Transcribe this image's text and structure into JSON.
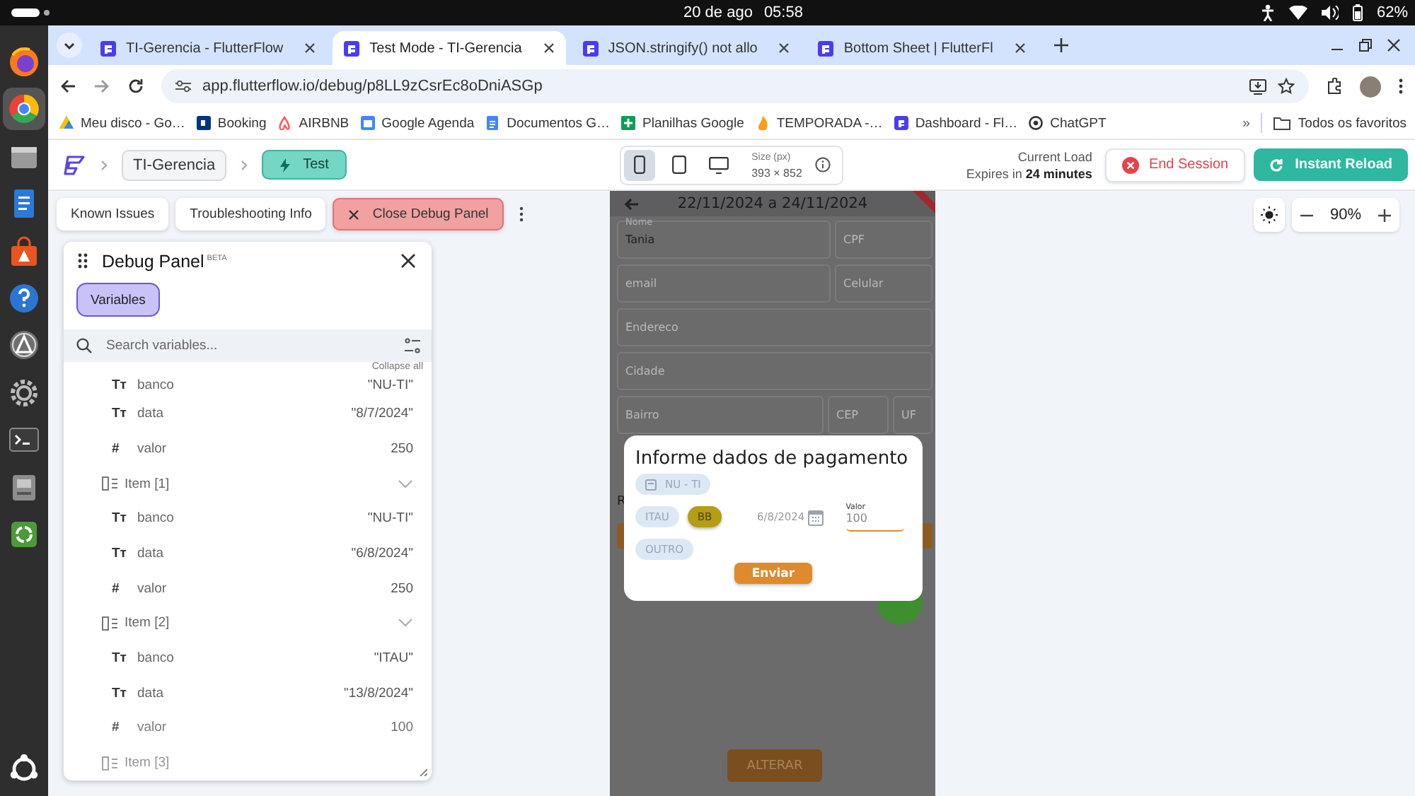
{
  "system_bar": {
    "date": "20 de ago",
    "time": "05:58",
    "battery": "62%"
  },
  "dock": {
    "apps": [
      {
        "kind": "globe",
        "selected": false
      },
      {
        "kind": "ring",
        "selected": true
      },
      {
        "kind": "drawer",
        "selected": false
      },
      {
        "kind": "document",
        "selected": false
      },
      {
        "kind": "bag",
        "selected": false
      },
      {
        "kind": "help",
        "selected": false
      },
      {
        "kind": "triangle",
        "selected": false
      },
      {
        "kind": "gear",
        "selected": false
      },
      {
        "kind": "terminal",
        "selected": false
      },
      {
        "kind": "disk",
        "selected": false
      },
      {
        "kind": "recycle",
        "selected": false
      }
    ]
  },
  "browser": {
    "tabs": [
      {
        "label": "TI-Gerencia - FlutterFlow",
        "selected": false
      },
      {
        "label": "Test Mode - TI-Gerencia",
        "selected": true
      },
      {
        "label": "JSON.stringify() not allo",
        "selected": false
      },
      {
        "label": "Bottom Sheet | FlutterFl",
        "selected": false
      }
    ],
    "url": "app.flutterflow.io/debug/p8LL9zCsrEc8oDniASGp",
    "bookmarks": [
      {
        "label": "Meu disco - Go…",
        "kind": "triangle"
      },
      {
        "label": "Booking",
        "kind": "square"
      },
      {
        "label": "AIRBNB",
        "kind": "loop"
      },
      {
        "label": "Google Agenda",
        "kind": "calendar"
      },
      {
        "label": "Documentos G…",
        "kind": "doc"
      },
      {
        "label": "Planilhas Google",
        "kind": "plus"
      },
      {
        "label": "TEMPORADA -…",
        "kind": "flame"
      },
      {
        "label": "Dashboard - Fl…",
        "kind": "logo"
      },
      {
        "label": "ChatGPT",
        "kind": "knot"
      }
    ],
    "overflow": "»",
    "all_bookmarks": "Todos os favoritos"
  },
  "header": {
    "breadcrumb": "TI-Gerencia",
    "mode_button": "Test",
    "devices": [
      {
        "kind": "phone",
        "selected": true
      },
      {
        "kind": "tablet",
        "selected": false
      },
      {
        "kind": "desktop",
        "selected": false
      }
    ],
    "size_label": "Size (px)",
    "size_value": "393 × 852",
    "load_label": "Current Load",
    "expiry": "Expires in **24 minutes**",
    "end_button": "End Session",
    "reload_button": "Instant Reload"
  },
  "toolbar": {
    "buttons": [
      {
        "label": "Known Issues",
        "kind": "plain"
      },
      {
        "label": "Troubleshooting Info",
        "kind": "plain"
      },
      {
        "label": "Close Debug Panel",
        "kind": "danger"
      }
    ]
  },
  "debug_panel": {
    "title": "Debug Panel",
    "badge": "BETA",
    "tabs": [
      {
        "label": "Variables",
        "selected": true
      }
    ],
    "search_placeholder": "Search variables...",
    "collapse_all": "Collapse all",
    "variables": [
      {
        "kind": "field",
        "icon": "Tт",
        "name": "banco",
        "value": "\"NU-TI\""
      },
      {
        "kind": "field",
        "icon": "Tт",
        "name": "data",
        "value": "\"8/7/2024\""
      },
      {
        "kind": "field",
        "icon": "#",
        "name": "valor",
        "value": "250"
      },
      {
        "kind": "group",
        "name": "Item [1]",
        "children": [
          {
            "kind": "field",
            "icon": "Tт",
            "name": "banco",
            "value": "\"NU-TI\""
          },
          {
            "kind": "field",
            "icon": "Tт",
            "name": "data",
            "value": "\"6/8/2024\""
          },
          {
            "kind": "field",
            "icon": "#",
            "name": "valor",
            "value": "250"
          }
        ]
      },
      {
        "kind": "group",
        "name": "Item [2]",
        "children": [
          {
            "kind": "field",
            "icon": "Tт",
            "name": "banco",
            "value": "\"ITAU\""
          },
          {
            "kind": "field",
            "icon": "Tт",
            "name": "data",
            "value": "\"13/8/2024\""
          },
          {
            "kind": "field",
            "icon": "#",
            "name": "valor",
            "value": "100"
          }
        ]
      },
      {
        "kind": "group",
        "name": "Item [3]"
      }
    ]
  },
  "zoom": "90%",
  "phone": {
    "date_range": "22/11/2024 a 24/11/2024",
    "form_rows": [
      [
        {
          "label": "Nome",
          "value": "Tania"
        },
        {
          "placeholder": "CPF"
        }
      ],
      [
        {
          "placeholder": "email"
        },
        {
          "placeholder": "Celular"
        }
      ],
      [
        {
          "placeholder": "Endereco"
        }
      ],
      [
        {
          "placeholder": "Cidade"
        }
      ],
      [
        {
          "placeholder": "Bairro"
        },
        {
          "placeholder": "CEP"
        },
        {
          "placeholder": "UF"
        }
      ]
    ],
    "partial_label": "R",
    "submit": "ALTERAR",
    "dialog": {
      "title": "Informe dados de pagamento",
      "chips": [
        {
          "label": "NU - TI",
          "kind": "icon",
          "selected": false
        },
        {
          "label": "ITAU",
          "kind": "plain",
          "selected": false
        },
        {
          "label": "BB",
          "kind": "plain",
          "selected": true
        },
        {
          "label": "OUTRO",
          "kind": "plain",
          "selected": false
        }
      ],
      "date": "6/8/2024",
      "amount_label": "Valor",
      "amount": "100",
      "send_button": "Enviar"
    }
  }
}
